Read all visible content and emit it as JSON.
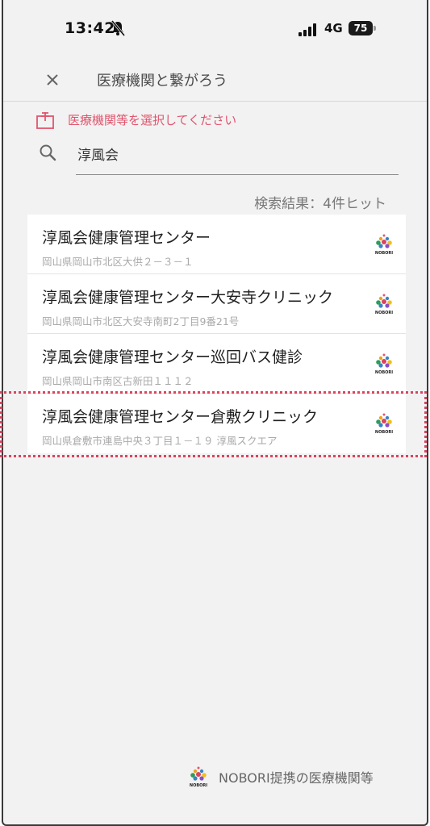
{
  "status_bar": {
    "time": "13:42",
    "network": "4G",
    "battery": "75"
  },
  "header": {
    "title": "医療機関と繋がろう",
    "close_icon": "close-icon"
  },
  "notice": {
    "icon": "hospital-icon",
    "text": "医療機関等を選択してください"
  },
  "search": {
    "icon": "search-icon",
    "value": "淳風会"
  },
  "results": {
    "count_text": "検索結果：4件ヒット",
    "items": [
      {
        "name": "淳風会健康管理センター",
        "address": "岡山県岡山市北区大供２－３－１",
        "logo": "nobori-logo"
      },
      {
        "name": "淳風会健康管理センター大安寺クリニック",
        "address": "岡山県岡山市北区大安寺南町2丁目9番21号",
        "logo": "nobori-logo"
      },
      {
        "name": "淳風会健康管理センター巡回バス健診",
        "address": "岡山県岡山市南区古新田１１１２",
        "logo": "nobori-logo"
      },
      {
        "name": "淳風会健康管理センター倉敷クリニック",
        "address": "岡山県倉敷市連島中央３丁目１－１９ 淳風スクエア",
        "logo": "nobori-logo"
      }
    ]
  },
  "footer": {
    "text": "NOBORI提携の医療機関等",
    "logo_word": "NOBORI"
  },
  "colors": {
    "accent": "#e0556e",
    "selection": "#d9445f",
    "background": "#f2f2f2"
  }
}
